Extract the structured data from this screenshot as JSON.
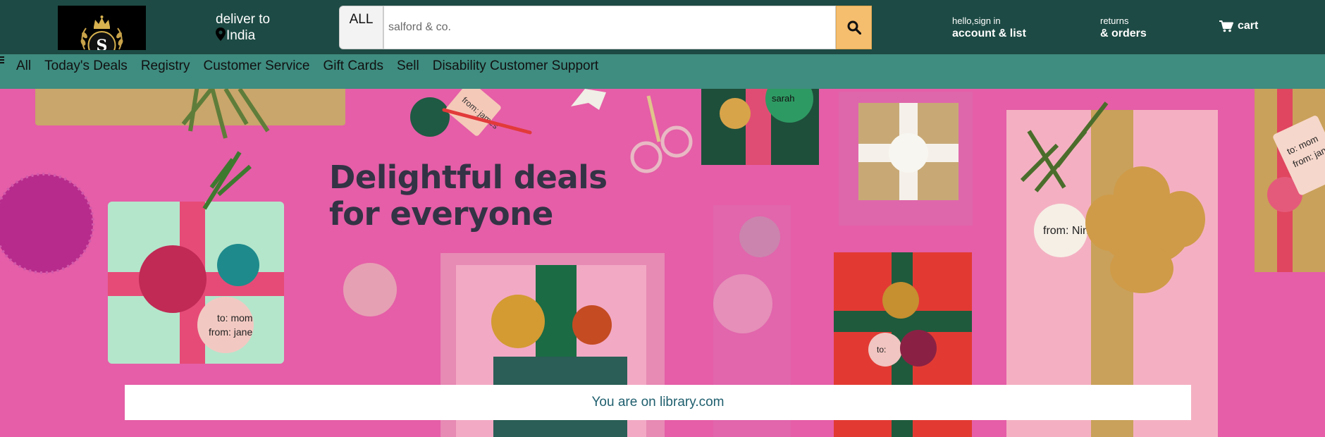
{
  "header": {
    "logo": {
      "letter": "S",
      "icon": "crown-logo-icon"
    },
    "deliver": {
      "line1": "deliver to",
      "line2": "India",
      "icon": "location-pin-icon"
    },
    "search": {
      "category": "ALL",
      "placeholder": "salford & co.",
      "value": "",
      "icon": "search-icon"
    },
    "account": {
      "greeting": "hello,sign in",
      "label": "account & list"
    },
    "orders": {
      "small": "returns",
      "label": "& orders"
    },
    "cart": {
      "label": "cart",
      "icon": "cart-icon"
    }
  },
  "nav": {
    "menu_icon": "hamburger-icon",
    "items": [
      {
        "label": "All"
      },
      {
        "label": "Today's Deals"
      },
      {
        "label": "Registry"
      },
      {
        "label": "Customer Service"
      },
      {
        "label": "Gift Cards"
      },
      {
        "label": "Sell"
      },
      {
        "label": "Disability Customer Support"
      }
    ]
  },
  "hero": {
    "headline_line1": "Delightful deals",
    "headline_line2": "for everyone",
    "tags": [
      "from: james",
      "sarah",
      "to: mom",
      "from: jane",
      "to:",
      "from: Nina",
      "to: mom",
      "from: jane"
    ]
  },
  "notice": {
    "text": "You are on library.com"
  },
  "colors": {
    "header_bg": "#1d4a44",
    "nav_bg": "#3f8c80",
    "search_button": "#f5bd6e",
    "hero_bg": "#e55ea7",
    "headline": "#333345",
    "notice_text": "#1f5f6e"
  }
}
